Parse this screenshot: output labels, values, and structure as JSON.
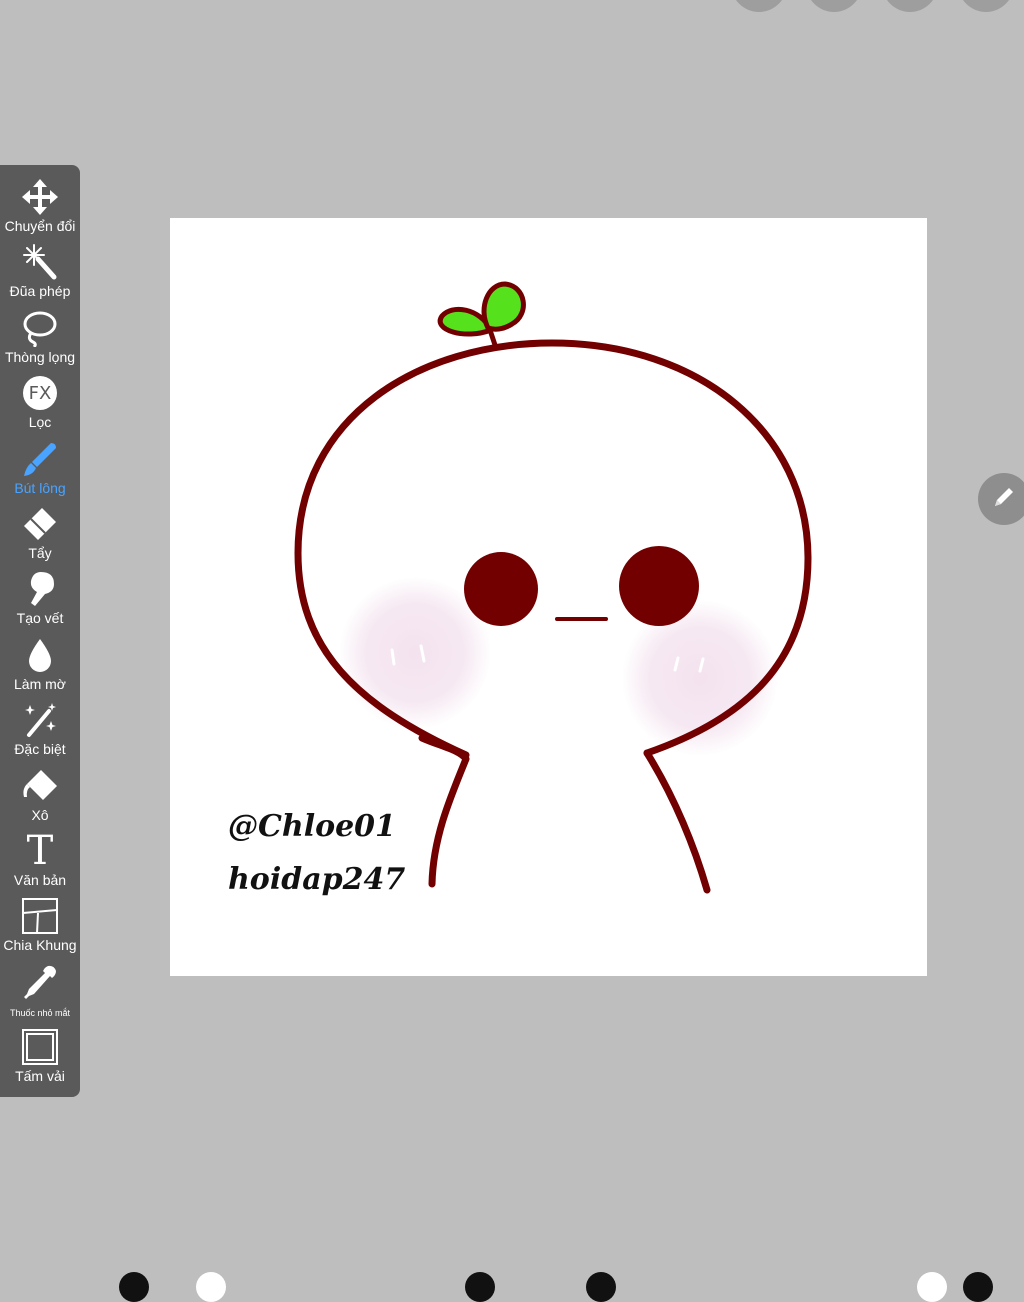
{
  "toolbar": {
    "tools": [
      {
        "label": "Chuyển đổi",
        "icon": "move-icon"
      },
      {
        "label": "Đũa phép",
        "icon": "magic-wand-icon"
      },
      {
        "label": "Thòng lọng",
        "icon": "lasso-icon"
      },
      {
        "label": "Lọc",
        "icon": "fx-filter-icon",
        "icon_text": "FX"
      },
      {
        "label": "Bút lông",
        "icon": "brush-icon",
        "active": true
      },
      {
        "label": "Tẩy",
        "icon": "eraser-icon"
      },
      {
        "label": "Tạo vết",
        "icon": "smudge-icon"
      },
      {
        "label": "Làm mờ",
        "icon": "blur-drop-icon"
      },
      {
        "label": "Đặc biệt",
        "icon": "special-effect-icon"
      },
      {
        "label": "Xô",
        "icon": "bucket-icon"
      },
      {
        "label": "Văn bản",
        "icon": "text-icon",
        "icon_text": "T"
      },
      {
        "label": "Chia Khung",
        "icon": "frame-divider-icon"
      },
      {
        "label": "Thuốc nhỏ mắt",
        "icon": "eyedropper-icon"
      },
      {
        "label": "Tấm vải",
        "icon": "canvas-icon"
      }
    ]
  },
  "canvas": {
    "watermark_lines": [
      "@Chloe01",
      "hoidap247"
    ]
  },
  "colors": {
    "background": "#bebebe",
    "toolbar": "#5a5a5a",
    "active_tool": "#4aa3ff",
    "outline": "#720000",
    "sprout": "#55e11c",
    "blush": "#f3e1ee"
  }
}
